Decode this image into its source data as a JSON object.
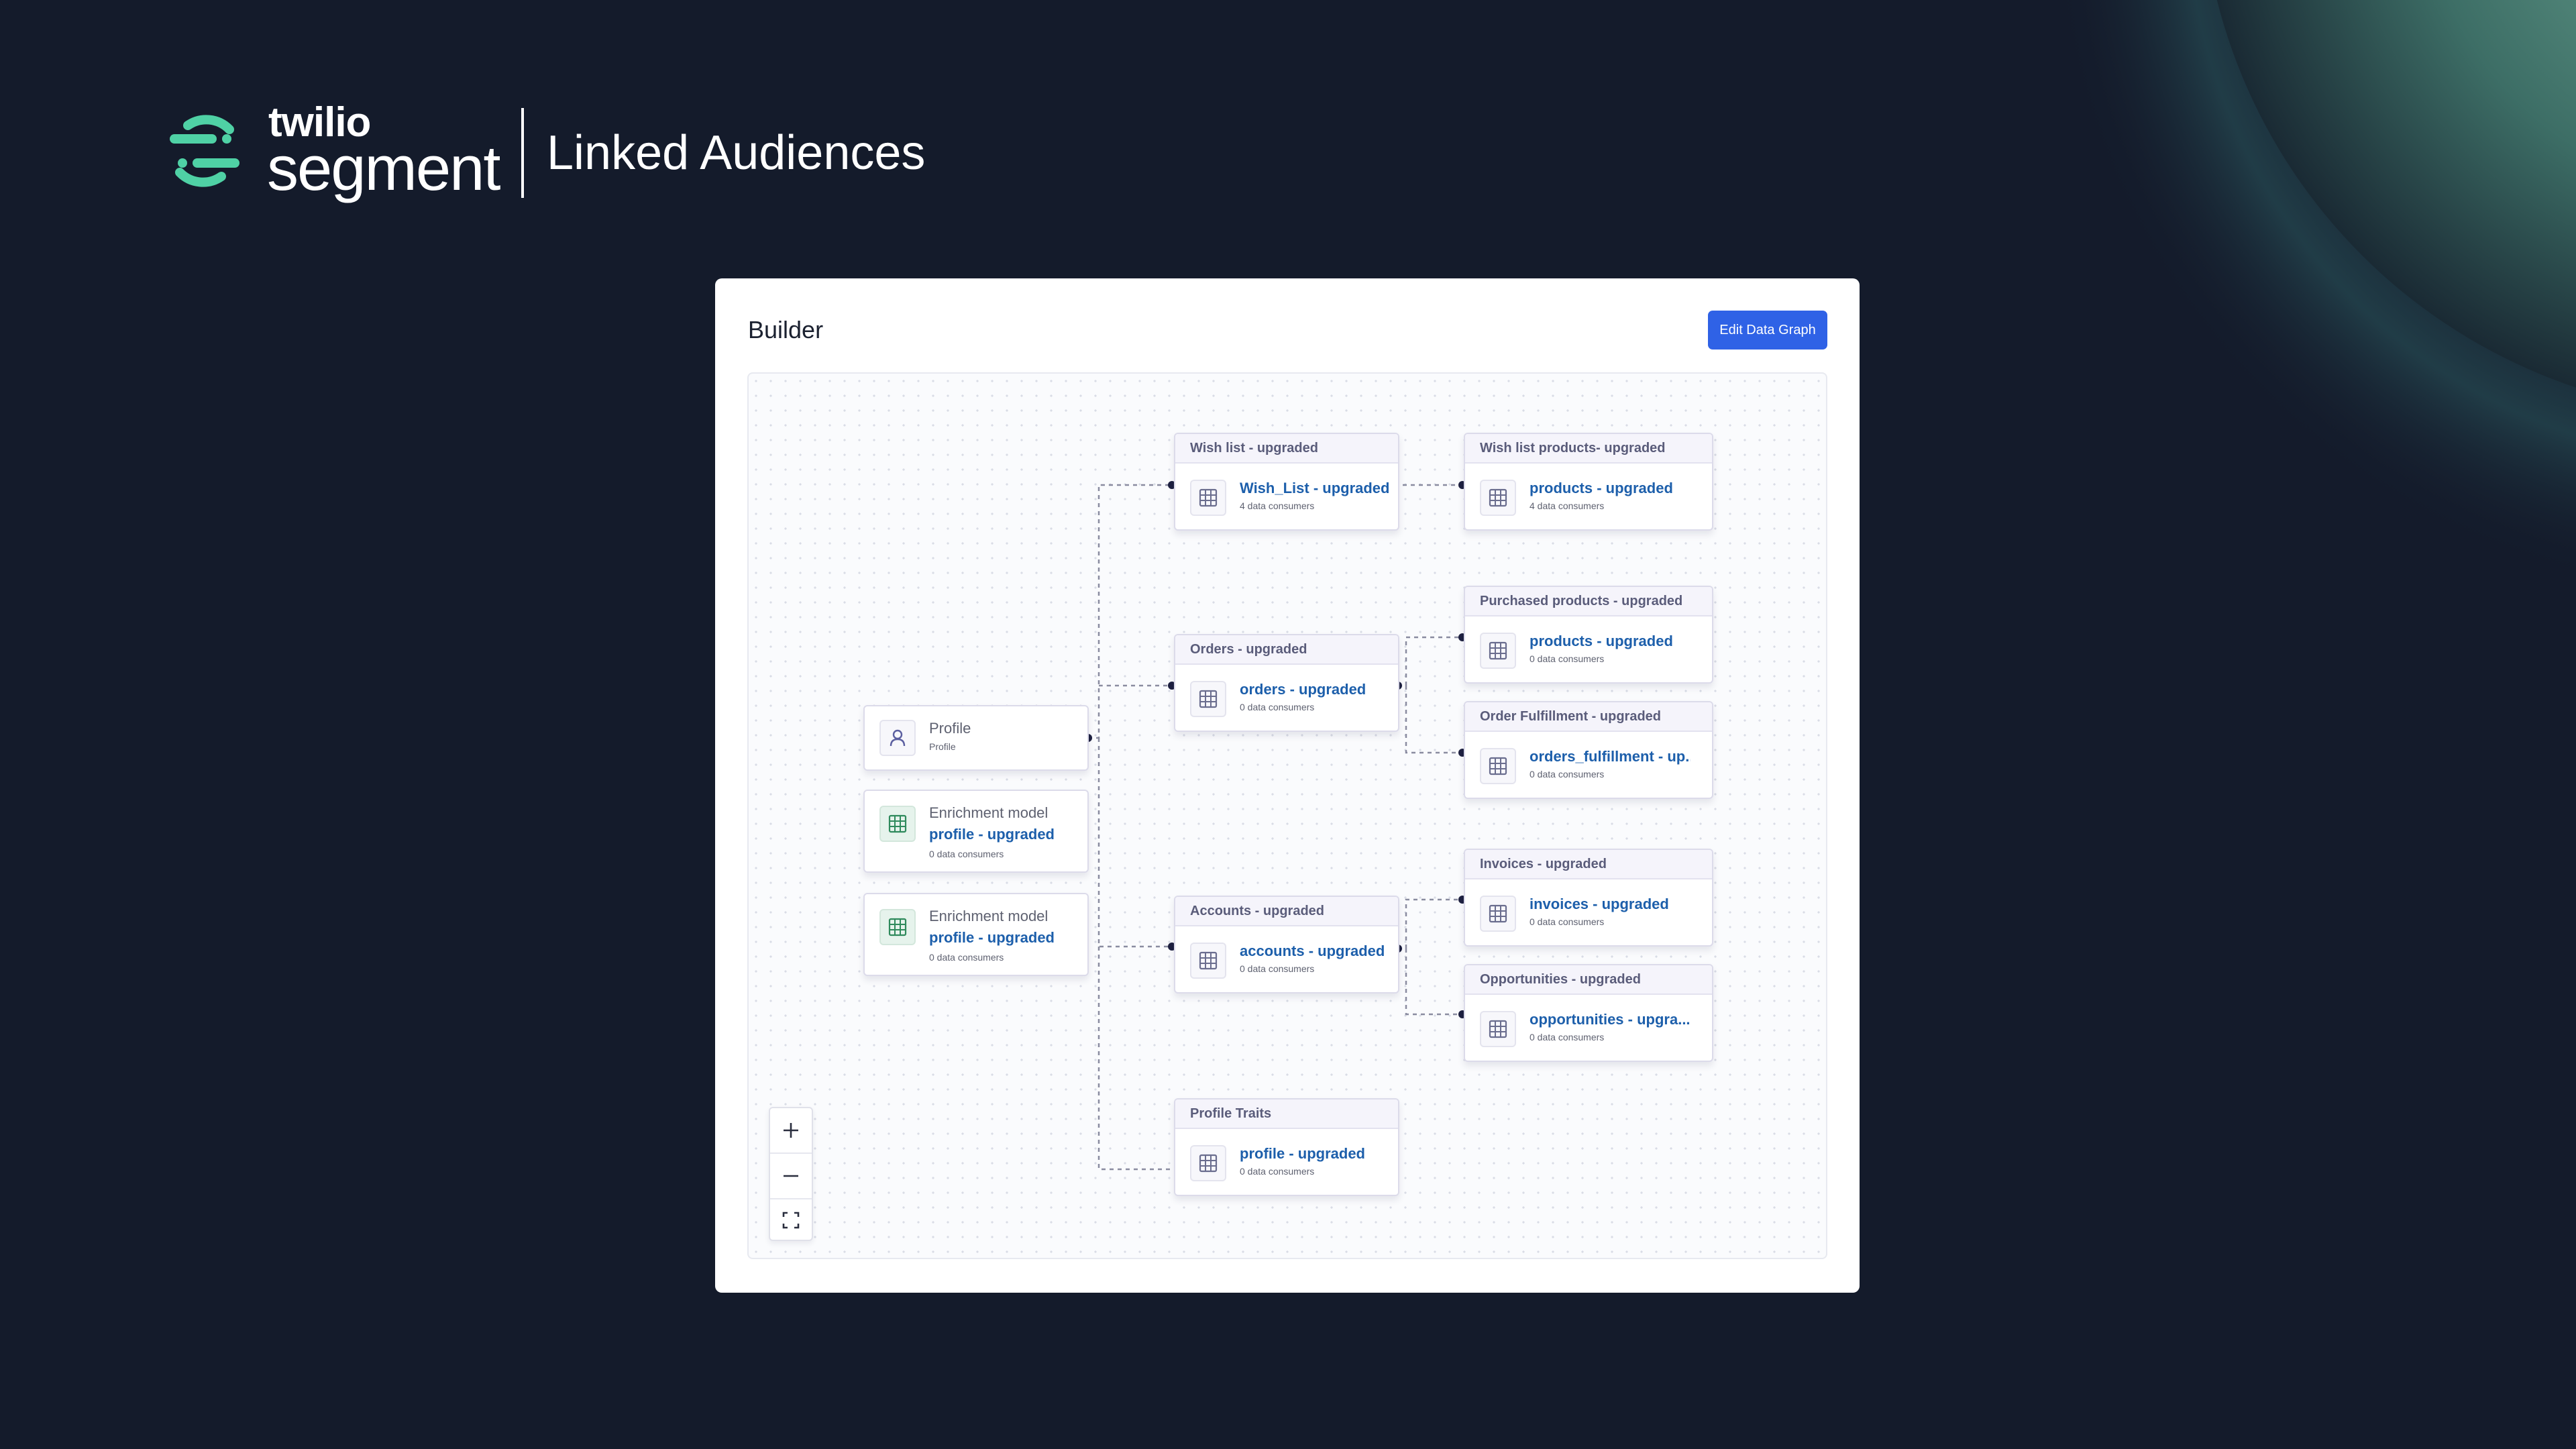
{
  "brand": {
    "twilio": "twilio",
    "segment": "segment",
    "product": "Linked Audiences",
    "accent": "#4fd1a5"
  },
  "builder": {
    "title": "Builder",
    "edit_button": "Edit Data Graph",
    "accent": "#2f62e6"
  },
  "left_nodes": {
    "profile": {
      "title": "Profile",
      "subtitle": "Profile"
    },
    "enrichment_1": {
      "label": "Enrichment model",
      "name": "profile - upgraded",
      "sub": "0 data consumers"
    },
    "enrichment_2": {
      "label": "Enrichment model",
      "name": "profile - upgraded",
      "sub": "0 data consumers"
    }
  },
  "nodes": {
    "wish_list": {
      "header": "Wish list - upgraded",
      "name": "Wish_List - upgraded",
      "sub": "4 data consumers"
    },
    "wish_list_products": {
      "header": "Wish list products- upgraded",
      "name": "products - upgraded",
      "sub": "4 data consumers"
    },
    "orders": {
      "header": "Orders - upgraded",
      "name": "orders - upgraded",
      "sub": "0 data consumers"
    },
    "purchased_products": {
      "header": "Purchased products - upgraded",
      "name": "products - upgraded",
      "sub": "0 data consumers"
    },
    "order_fulfillment": {
      "header": "Order Fulfillment - upgraded",
      "name": "orders_fulfillment - up...",
      "sub": "0 data consumers"
    },
    "accounts": {
      "header": "Accounts - upgraded",
      "name": "accounts - upgraded",
      "sub": "0 data consumers"
    },
    "invoices": {
      "header": "Invoices -  upgraded",
      "name": "invoices - upgraded",
      "sub": "0 data consumers"
    },
    "opportunities": {
      "header": "Opportunities - upgraded",
      "name": "opportunities - upgra...",
      "sub": "0 data consumers"
    },
    "profile_traits": {
      "header": "Profile Traits",
      "name": "profile - upgraded",
      "sub": "0 data consumers"
    }
  },
  "icons": {
    "table": "table-icon",
    "profile": "person-icon",
    "zoom_in": "plus-icon",
    "zoom_out": "minus-icon",
    "fit": "fit-view-icon"
  }
}
